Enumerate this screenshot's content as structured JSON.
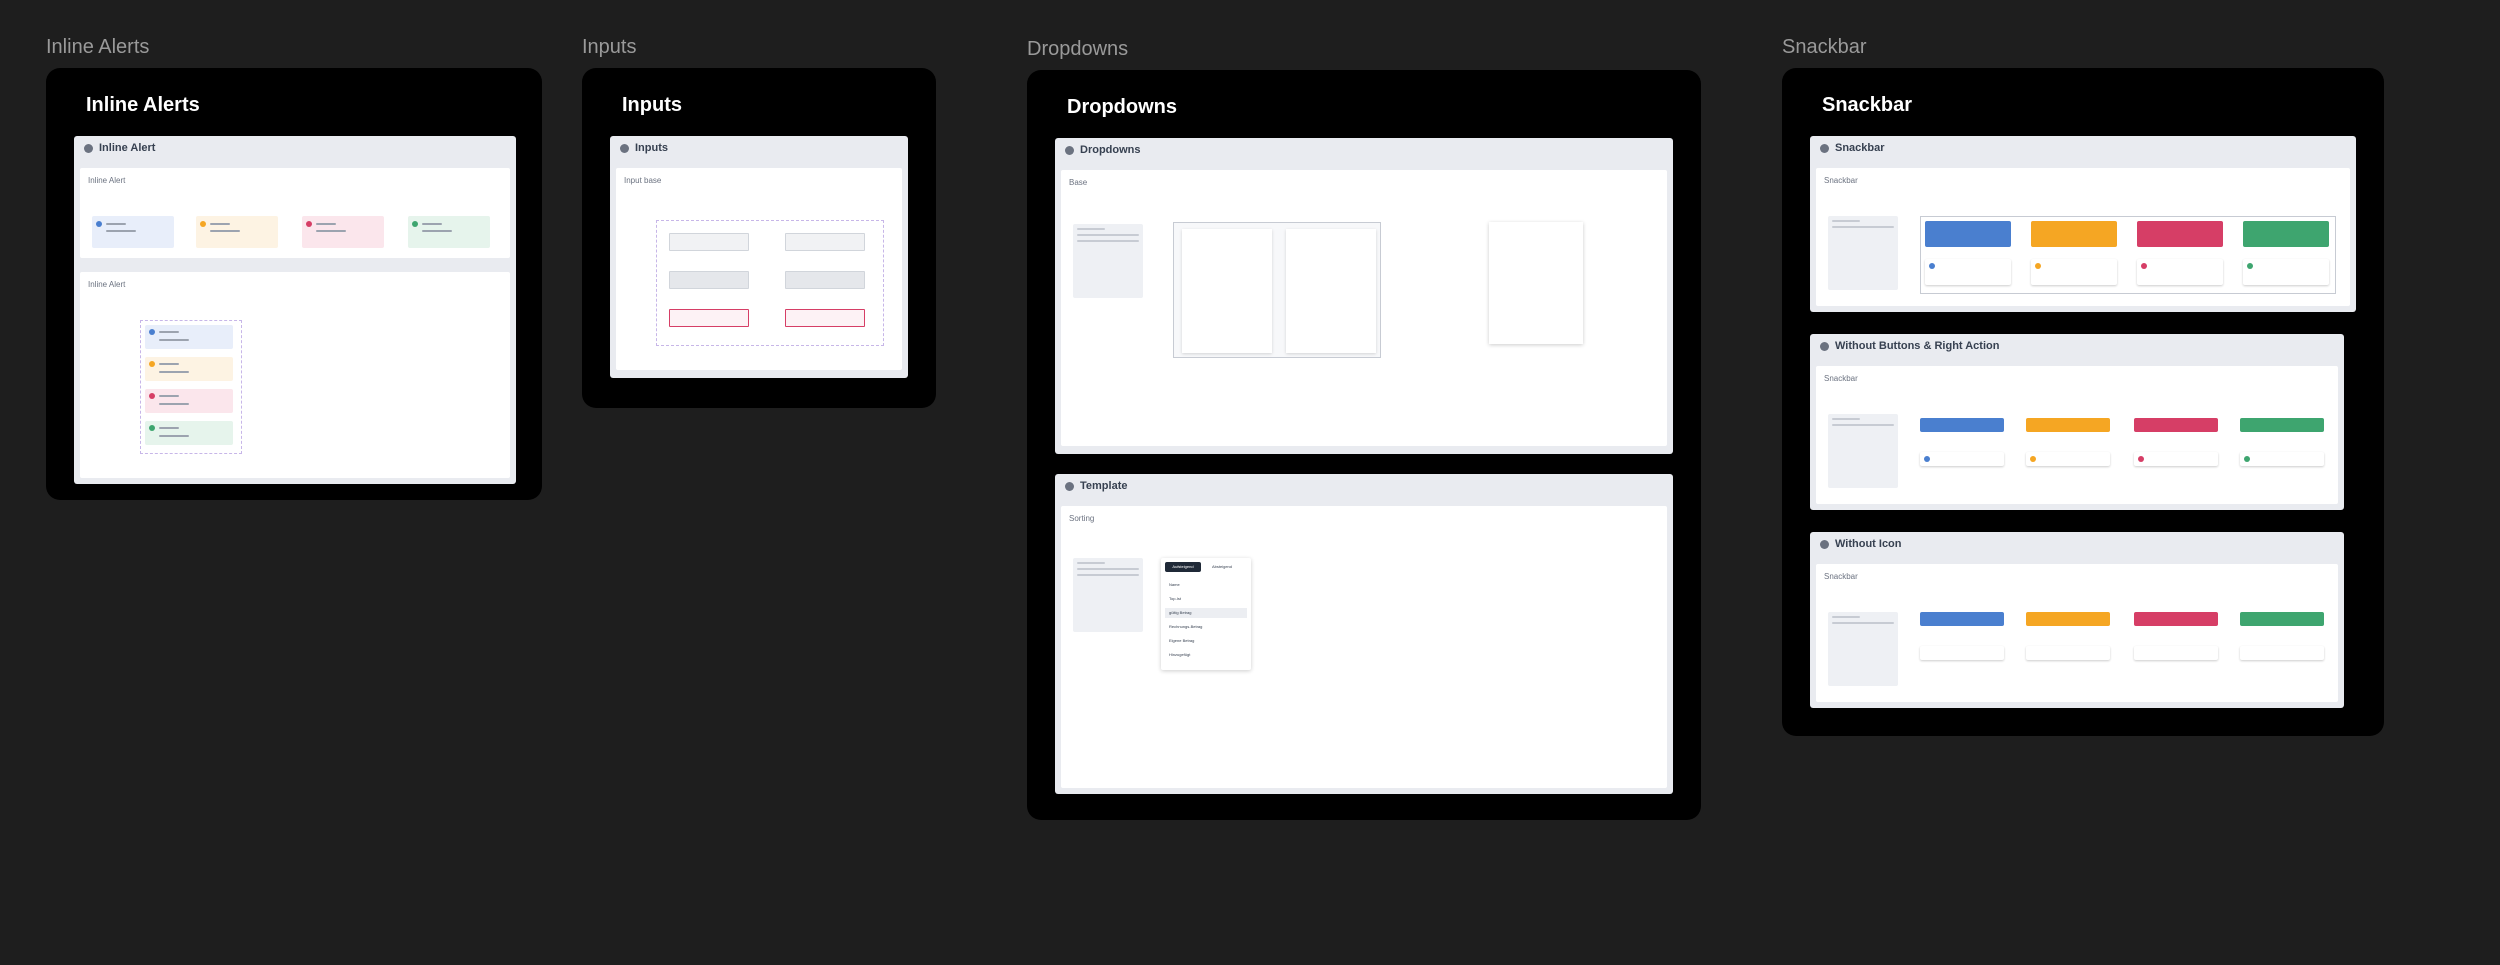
{
  "frames": {
    "inline_alerts": {
      "label": "Inline Alerts",
      "title": "Inline Alerts"
    },
    "inputs": {
      "label": "Inputs",
      "title": "Inputs"
    },
    "dropdowns": {
      "label": "Dropdowns",
      "title": "Dropdowns"
    },
    "snackbar": {
      "label": "Snackbar",
      "title": "Snackbar"
    }
  },
  "panels": {
    "inline_alert": "Inline Alert",
    "inputs": "Inputs",
    "dropdowns": "Dropdowns",
    "template": "Template",
    "snackbar": "Snackbar",
    "without_buttons": "Without Buttons & Right Action",
    "without_icon": "Without Icon"
  },
  "sections": {
    "inline_alert_1": "Inline Alert",
    "inline_alert_2": "Inline Alert",
    "input_base": "Input base",
    "base": "Base",
    "sorting": "Sorting",
    "snackbar_1": "Snackbar",
    "snackbar_2": "Snackbar",
    "snackbar_3": "Snackbar"
  },
  "sorting_menu": {
    "tab_active": "Aufsteigend",
    "tab_inactive": "Absteigend",
    "items": [
      "Name",
      "Top-Ist",
      "gültig Betrag",
      "Rechnungs-Betrag",
      "Eigene Betrag",
      "Hinzugefügt"
    ]
  },
  "colors": {
    "info": "#4a7fcf",
    "warning": "#f5a623",
    "error": "#d63e66",
    "success": "#3ea56f"
  }
}
